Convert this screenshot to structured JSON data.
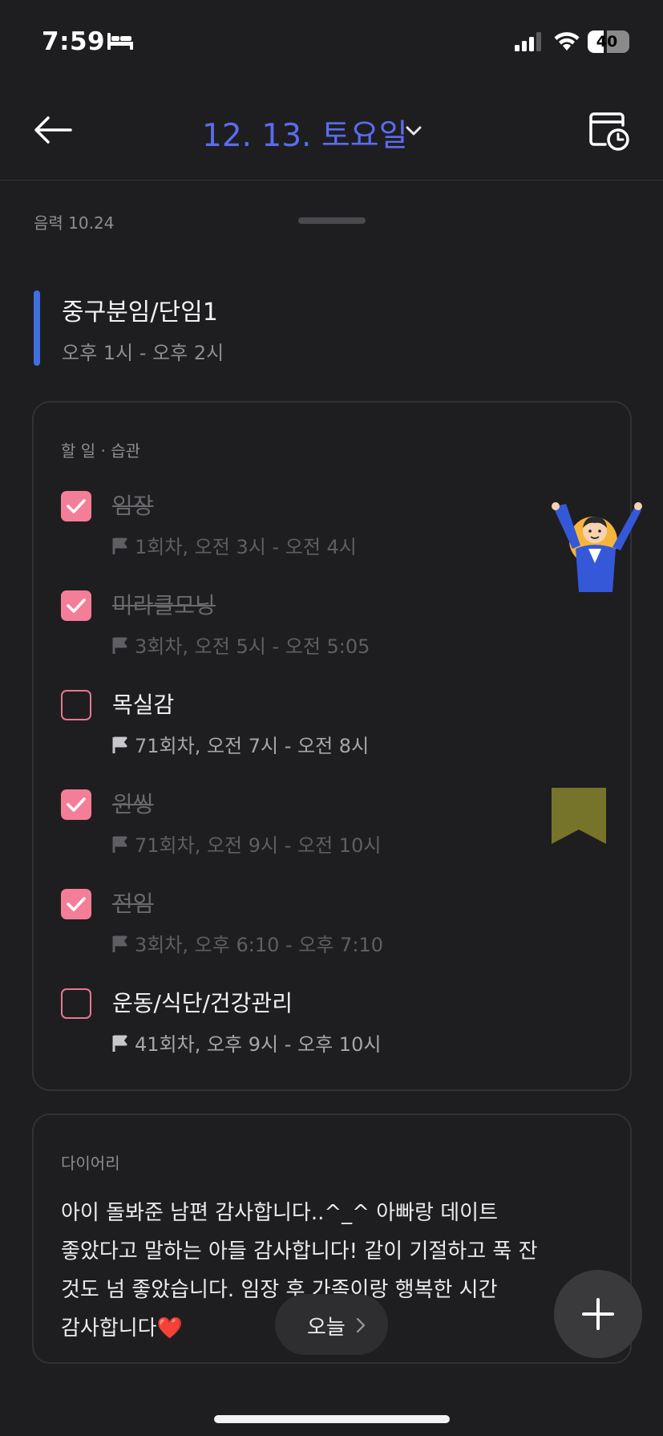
{
  "status_bar": {
    "time": "7:59",
    "battery": "40",
    "icons": [
      "bed-icon",
      "signal-icon",
      "wifi-icon",
      "battery-icon"
    ]
  },
  "nav": {
    "date": "12. 13. 토요일",
    "accent_color": "#5b6cf0",
    "icons": [
      "back-arrow-icon",
      "chevron-down-icon",
      "calendar-history-icon"
    ]
  },
  "lunar": "음력 10.24",
  "event": {
    "title": "중구분임/단임1",
    "time": "오후 1시 - 오후 2시",
    "color": "#3f6fe0"
  },
  "todo": {
    "label": "할 일 · 습관",
    "items": [
      {
        "title": "임장",
        "meta": "1회차, 오전 3시 - 오전 4시",
        "checked": true
      },
      {
        "title": "미라클모닝",
        "meta": "3회차, 오전 5시 - 오전 5:05",
        "checked": true
      },
      {
        "title": "목실감",
        "meta": "71회차, 오전 7시 - 오전 8시",
        "checked": false
      },
      {
        "title": "윈씽",
        "meta": "71회차, 오전 9시 - 오전 10시",
        "checked": true
      },
      {
        "title": "전임",
        "meta": "3회차, 오후 6:10 - 오후 7:10",
        "checked": true
      },
      {
        "title": "운동/식단/건강관리",
        "meta": "41회차, 오후 9시 - 오후 10시",
        "checked": false
      }
    ],
    "checkbox_color": "#f47e98"
  },
  "diary": {
    "label": "다이어리",
    "text": "아이 돌봐준 남편 감사합니다..^_^ 아빠랑 데이트\n좋았다고 말하는 아들 감사합니다! 같이 기절하고 푹 잔\n것도 넘 좋았습니다. 임장 후 가족이랑 행복한 시간\n감사합니다❤️"
  },
  "today_button": {
    "label": "오늘"
  },
  "fab": {
    "icon": "plus-icon"
  }
}
